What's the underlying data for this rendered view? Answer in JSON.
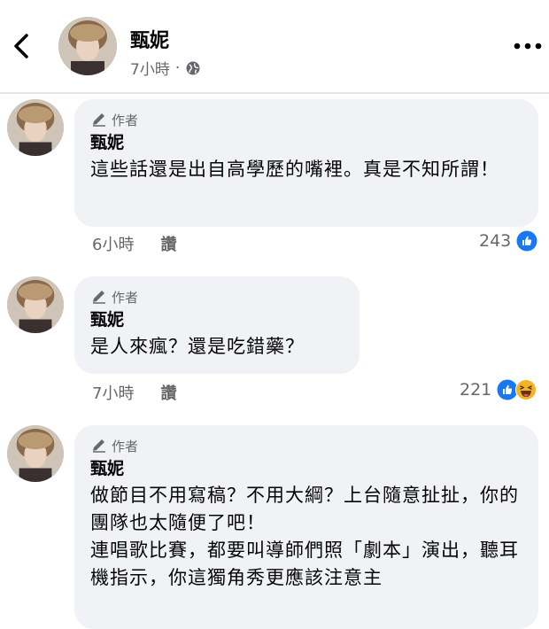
{
  "header": {
    "name": "甄妮",
    "time": "7小時",
    "dot": "·"
  },
  "comments": [
    {
      "badge": "作者",
      "author": "甄妮",
      "text": "這些話還是出自高學歷的嘴裡。真是不知所謂！",
      "time": "6小時",
      "like_label": "讚",
      "count": "243",
      "reactions": [
        "like-icon"
      ]
    },
    {
      "badge": "作者",
      "author": "甄妮",
      "text": "是人來瘋？還是吃錯藥？",
      "time": "7小時",
      "like_label": "讚",
      "count": "221",
      "reactions": [
        "like-icon",
        "haha-icon"
      ]
    },
    {
      "badge": "作者",
      "author": "甄妮",
      "text": "做節目不用寫稿？不用大綱？上台隨意扯扯，你的團隊也太隨便了吧！\n連唱歌比賽，都要叫導師們照「劇本」演出，聽耳機指示，你這獨角秀更應該注意主",
      "time": "",
      "like_label": "",
      "count": "",
      "reactions": []
    }
  ],
  "colors": {
    "like_blue": "#1877f2",
    "haha_yellow": "#f7b125",
    "bubble_bg": "#f0f2f5",
    "meta_gray": "#65676b"
  }
}
